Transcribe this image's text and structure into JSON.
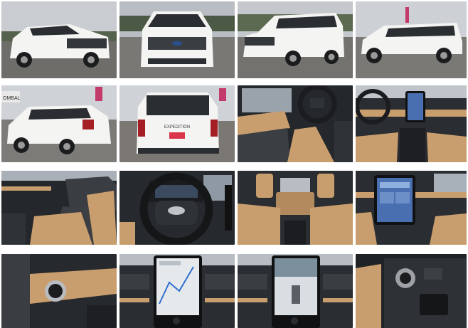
{
  "gallery": {
    "photos": [
      {
        "subject": "exterior-front-three-quarter"
      },
      {
        "subject": "exterior-front"
      },
      {
        "subject": "exterior-front-side"
      },
      {
        "subject": "exterior-side-profile"
      },
      {
        "subject": "exterior-rear-three-quarter"
      },
      {
        "subject": "exterior-rear"
      },
      {
        "subject": "interior-driver-door"
      },
      {
        "subject": "interior-dashboard"
      },
      {
        "subject": "interior-passenger-side"
      },
      {
        "subject": "interior-steering-wheel"
      },
      {
        "subject": "interior-rear-seats"
      },
      {
        "subject": "interior-center-screen"
      },
      {
        "subject": "interior-start-button"
      },
      {
        "subject": "interior-navigation-screen"
      },
      {
        "subject": "interior-camera-screen"
      },
      {
        "subject": "interior-gear-selector"
      }
    ],
    "signage": {
      "dealer_sign_fragment": "OMBAL"
    },
    "rear_badge": "EXPEDITION",
    "colors": {
      "body_white": "#f4f4f2",
      "sky": "#c9ccd0",
      "asphalt": "#6f6d69",
      "dark_trim": "#2a2d31",
      "saddle_leather": "#c99e6e",
      "screen_blue": "#4a6fb0"
    }
  }
}
